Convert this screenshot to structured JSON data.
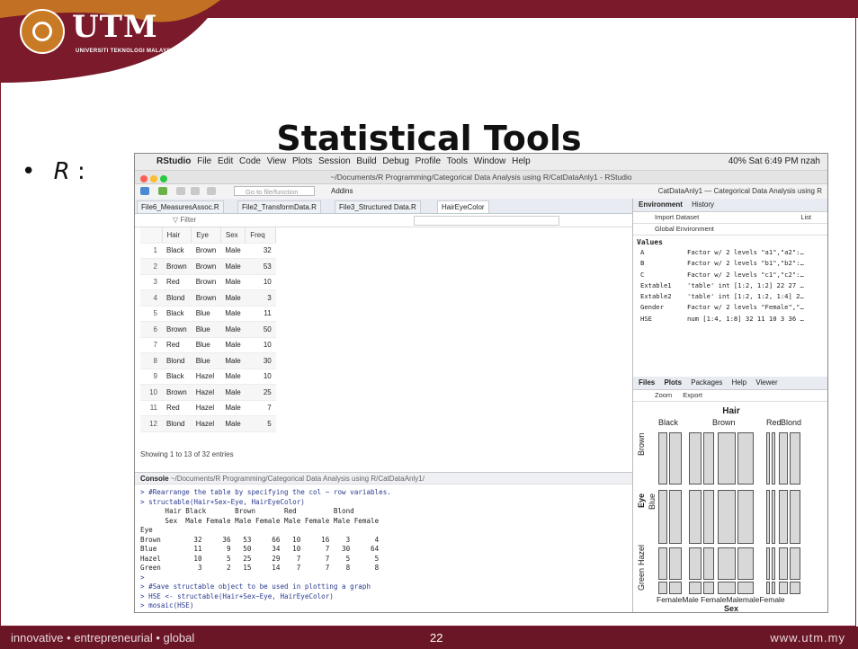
{
  "slide": {
    "logo_text": "UTM",
    "logo_subtitle": "UNIVERSITI TEKNOLOGI MALAYSIA",
    "title": "Statistical Tools",
    "bullet_label": "R",
    "bullet_colon": ":",
    "footer_left": "innovative • entrepreneurial • global",
    "footer_page": "22",
    "footer_url": "www.utm.my",
    "colors": {
      "brand": "#7a1a2a",
      "accent": "#c97a24"
    }
  },
  "rstudio": {
    "menubar": {
      "app": "RStudio",
      "items": [
        "File",
        "Edit",
        "Code",
        "View",
        "Plots",
        "Session",
        "Build",
        "Debug",
        "Profile",
        "Tools",
        "Window",
        "Help"
      ],
      "status": "40%  Sat 6:49 PM  nzah"
    },
    "window_title": "~/Documents/R Programming/Categorical Data Analysis using R/CatDataAnly1 - RStudio",
    "toolbar": {
      "goto_placeholder": "Go to file/function",
      "addins": "Addins",
      "project": "CatDataAnly1 — Categorical Data Analysis using R"
    },
    "source_tabs": [
      "File6_MeasuresAssoc.R",
      "File2_TransformData.R",
      "File3_Structured Data.R",
      "HairEyeColor"
    ],
    "filter_label": "Filter",
    "table": {
      "columns": [
        "Hair",
        "Eye",
        "Sex",
        "Freq"
      ],
      "rows": [
        [
          "1",
          "Black",
          "Brown",
          "Male",
          "32"
        ],
        [
          "2",
          "Brown",
          "Brown",
          "Male",
          "53"
        ],
        [
          "3",
          "Red",
          "Brown",
          "Male",
          "10"
        ],
        [
          "4",
          "Blond",
          "Brown",
          "Male",
          "3"
        ],
        [
          "5",
          "Black",
          "Blue",
          "Male",
          "11"
        ],
        [
          "6",
          "Brown",
          "Blue",
          "Male",
          "50"
        ],
        [
          "7",
          "Red",
          "Blue",
          "Male",
          "10"
        ],
        [
          "8",
          "Blond",
          "Blue",
          "Male",
          "30"
        ],
        [
          "9",
          "Black",
          "Hazel",
          "Male",
          "10"
        ],
        [
          "10",
          "Brown",
          "Hazel",
          "Male",
          "25"
        ],
        [
          "11",
          "Red",
          "Hazel",
          "Male",
          "7"
        ],
        [
          "12",
          "Blond",
          "Hazel",
          "Male",
          "5"
        ]
      ],
      "showing": "Showing 1 to 13 of 32 entries"
    },
    "console": {
      "label": "Console",
      "path": "~/Documents/R Programming/Categorical Data Analysis using R/CatDataAnly1/",
      "lines": [
        "> #Rearrange the table by specifying the col ~ row variables.",
        "> structable(Hair+Sex~Eye, HairEyeColor)",
        "      Hair Black       Brown       Red         Blond",
        "      Sex  Male Female Male Female Male Female Male Female",
        "Eye",
        "Brown        32     36   53     66   10     16    3      4",
        "Blue         11      9   50     34   10      7   30     64",
        "Hazel        10      5   25     29    7      7    5      5",
        "Green         3      2   15     14    7      7    8      8",
        ">",
        "> #Save structable object to be used in plotting a graph",
        "> HSE <- structable(Hair+Sex~Eye, HairEyeColor)",
        "> mosaic(HSE)",
        ">"
      ]
    },
    "environment": {
      "tabs": [
        "Environment",
        "History"
      ],
      "import": "Import Dataset",
      "list": "List",
      "scope": "Global Environment",
      "values_title": "Values",
      "rows": [
        [
          "A",
          "Factor w/ 2 levels \"a1\",\"a2\":…"
        ],
        [
          "B",
          "Factor w/ 2 levels \"b1\",\"b2\":…"
        ],
        [
          "C",
          "Factor w/ 2 levels \"c1\",\"c2\":…"
        ],
        [
          "Extable1",
          "'table' int [1:2, 1:2] 22 27 …"
        ],
        [
          "Extable2",
          "'table' int [1:2, 1:2, 1:4] 2…"
        ],
        [
          "Gender",
          "Factor w/ 2 levels \"Female\",\"…"
        ],
        [
          "HSE",
          "num [1:4, 1:8] 32 11 10 3 36 …"
        ]
      ]
    },
    "files": {
      "tabs": [
        "Files",
        "Plots",
        "Packages",
        "Help",
        "Viewer"
      ],
      "zoom": "Zoom",
      "export": "Export"
    },
    "mosaic": {
      "top_title": "Hair",
      "hair_levels": [
        "Black",
        "Brown",
        "Red",
        "Blond"
      ],
      "eye_axis": "Eye",
      "eye_levels": [
        "Brown",
        "Blue",
        "Hazel",
        "Green"
      ],
      "sex_levels_text": "FemaleMale FemaleMalemaleFemale",
      "bottom_title": "Sex",
      "tile_fill": "#d8d8d8"
    }
  }
}
